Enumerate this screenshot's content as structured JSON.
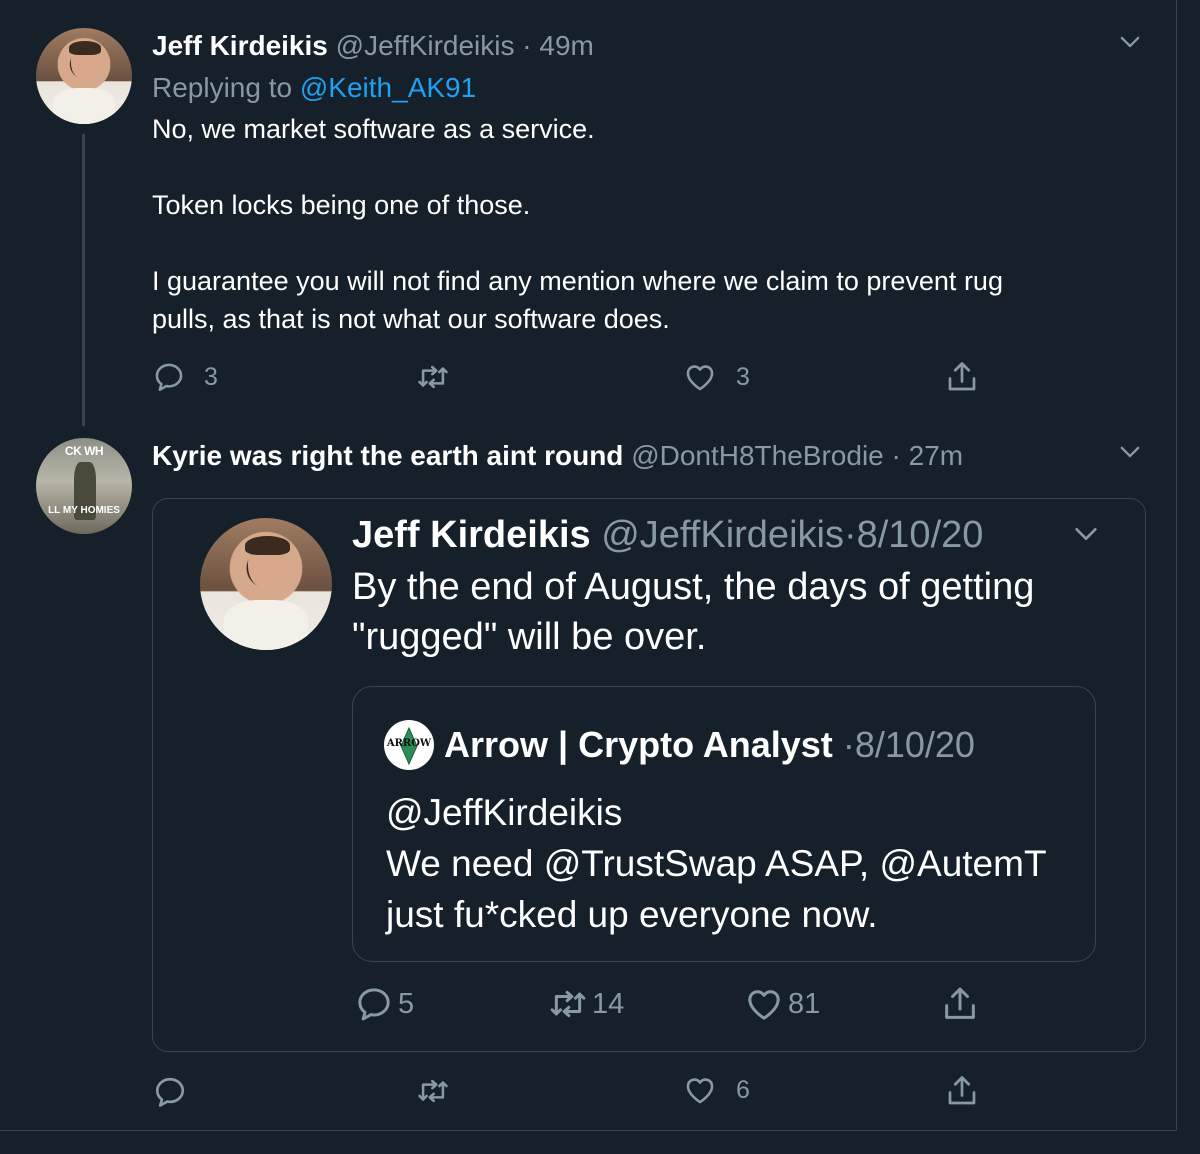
{
  "tweet1": {
    "name": "Jeff Kirdeikis",
    "handle": "@JeffKirdeikis",
    "sep": "·",
    "time": "49m",
    "replying_prefix": "Replying to",
    "replying_to": "@Keith_AK91",
    "lines": [
      "No, we market software as a service.",
      "Token locks being one of those.",
      "I guarantee you will not find any mention where we claim to prevent rug",
      "pulls, as that is not what our software does."
    ],
    "reply_count": "3",
    "like_count": "3"
  },
  "tweet2": {
    "name": "Kyrie was right the earth aint round",
    "handle": "@DontH8TheBrodie",
    "sep": "·",
    "time": "27m",
    "avatar_top_text": "CK WH",
    "avatar_bottom_text": "LL MY HOMIES",
    "like_count": "6"
  },
  "quoted": {
    "name": "Jeff Kirdeikis",
    "handle": "@JeffKirdeikis",
    "sep": "·",
    "time": "8/10/20",
    "lines": [
      "By the end of August, the days of getting",
      "\"rugged\" will be over."
    ],
    "reply_count": "5",
    "retweet_count": "14",
    "like_count": "81"
  },
  "nested": {
    "name": "Arrow | Crypto Analyst",
    "sep": "·",
    "time": "8/10/20",
    "avatar_text": "ARROW",
    "lines": [
      "@JeffKirdeikis",
      "We need @TrustSwap ASAP, @AutemT",
      "just fu*cked up everyone now."
    ]
  },
  "colors": {
    "background": "#15202b",
    "border": "#38444d",
    "muted": "#8899a6",
    "accent": "#1da1f2"
  },
  "icons": [
    "chevron-down-icon",
    "reply-icon",
    "retweet-icon",
    "like-icon",
    "share-icon"
  ]
}
